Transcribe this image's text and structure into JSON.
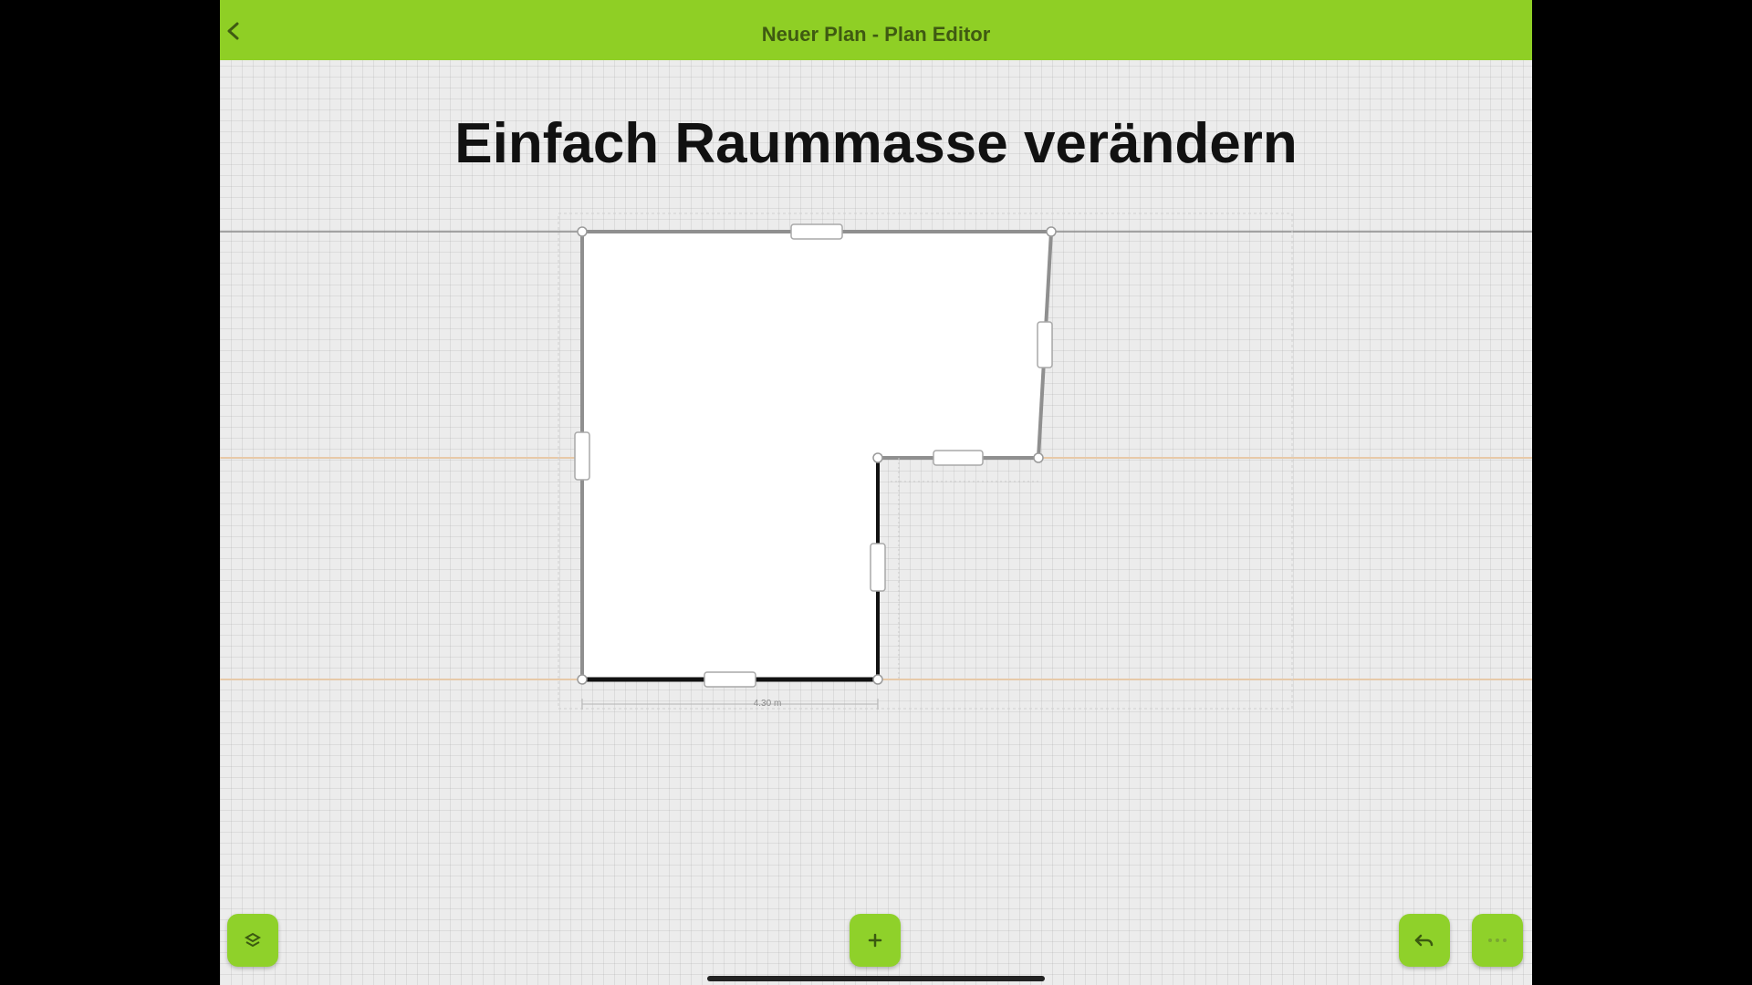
{
  "header": {
    "title": "Neuer Plan - Plan Editor",
    "back_icon": "chevron-left-icon",
    "color": "#8fcf25"
  },
  "overlay": {
    "headline": "Einfach Raummasse verändern"
  },
  "plan": {
    "room_shape": "L-shaped room",
    "dimension_label": "4.30 m"
  },
  "toolbar": {
    "left_button_icon": "layers-icon",
    "center_button_icon": "add-icon",
    "undo_icon": "undo-icon",
    "more_icon": "more-icon",
    "accent": "#8fd12a"
  }
}
